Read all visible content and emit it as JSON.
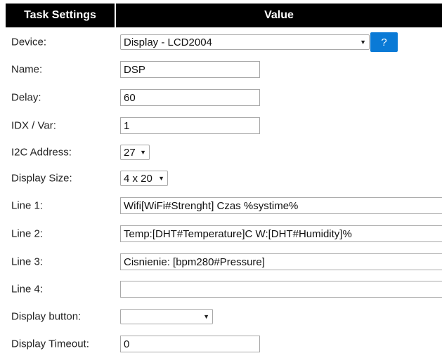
{
  "table": {
    "header_label": "Task Settings",
    "header_value": "Value"
  },
  "rows": {
    "device": {
      "label": "Device:",
      "value": "Display - LCD2004",
      "help": "?"
    },
    "name": {
      "label": "Name:",
      "value": "DSP"
    },
    "delay": {
      "label": "Delay:",
      "value": "60"
    },
    "idx": {
      "label": "IDX / Var:",
      "value": "1"
    },
    "i2c": {
      "label": "I2C Address:",
      "value": "27"
    },
    "display_size": {
      "label": "Display Size:",
      "value": "4 x 20"
    },
    "line1": {
      "label": "Line 1:",
      "value": "Wifi[WiFi#Strenght] Czas %systime%"
    },
    "line2": {
      "label": "Line 2:",
      "value": "Temp:[DHT#Temperature]C W:[DHT#Humidity]%"
    },
    "line3": {
      "label": "Line 3:",
      "value": "Cisnienie: [bpm280#Pressure]"
    },
    "line4": {
      "label": "Line 4:",
      "value": ""
    },
    "display_button": {
      "label": "Display button:",
      "value": ""
    },
    "display_timeout": {
      "label": "Display Timeout:",
      "value": "0"
    }
  },
  "colors": {
    "header_bg": "#000000",
    "help_button_bg": "#0a7ad6"
  },
  "icons": {
    "dropdown": "chevron-down-icon"
  }
}
